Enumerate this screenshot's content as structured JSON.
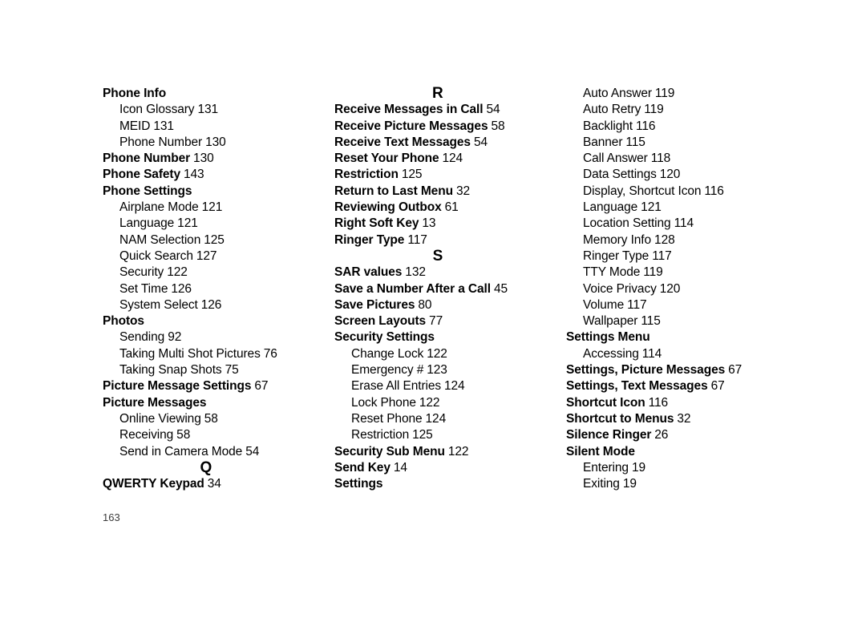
{
  "document": {
    "page_number": "163",
    "type": "index"
  },
  "columns": [
    {
      "id": "column-1",
      "blocks": [
        {
          "kind": "entries",
          "entries": [
            {
              "label": "Phone Info",
              "page": "",
              "level": "main"
            },
            {
              "label": "Icon Glossary",
              "page": "131",
              "level": "sub"
            },
            {
              "label": "MEID",
              "page": "131",
              "level": "sub"
            },
            {
              "label": "Phone Number",
              "page": "130",
              "level": "sub"
            },
            {
              "label": "Phone Number",
              "page": "130",
              "level": "main"
            },
            {
              "label": "Phone Safety",
              "page": "143",
              "level": "main"
            },
            {
              "label": "Phone Settings",
              "page": "",
              "level": "main"
            },
            {
              "label": "Airplane Mode",
              "page": "121",
              "level": "sub"
            },
            {
              "label": "Language",
              "page": "121",
              "level": "sub"
            },
            {
              "label": "NAM Selection",
              "page": "125",
              "level": "sub"
            },
            {
              "label": "Quick Search",
              "page": "127",
              "level": "sub"
            },
            {
              "label": "Security",
              "page": "122",
              "level": "sub"
            },
            {
              "label": "Set Time",
              "page": "126",
              "level": "sub"
            },
            {
              "label": "System Select",
              "page": "126",
              "level": "sub"
            },
            {
              "label": "Photos",
              "page": "",
              "level": "main"
            },
            {
              "label": "Sending",
              "page": "92",
              "level": "sub"
            },
            {
              "label": "Taking Multi Shot Pictures",
              "page": "76",
              "level": "sub"
            },
            {
              "label": "Taking Snap Shots",
              "page": "75",
              "level": "sub"
            },
            {
              "label": "Picture Message Settings",
              "page": "67",
              "level": "main"
            },
            {
              "label": "Picture Messages",
              "page": "",
              "level": "main"
            },
            {
              "label": "Online Viewing",
              "page": "58",
              "level": "sub"
            },
            {
              "label": "Receiving",
              "page": "58",
              "level": "sub"
            },
            {
              "label": "Send in Camera Mode",
              "page": "54",
              "level": "sub"
            }
          ]
        },
        {
          "kind": "letter",
          "letter": "Q"
        },
        {
          "kind": "entries",
          "entries": [
            {
              "label": "QWERTY Keypad",
              "page": "34",
              "level": "main"
            }
          ]
        }
      ]
    },
    {
      "id": "column-2",
      "blocks": [
        {
          "kind": "letter",
          "letter": "R"
        },
        {
          "kind": "entries",
          "entries": [
            {
              "label": "Receive Messages in Call",
              "page": "54",
              "level": "main"
            },
            {
              "label": "Receive Picture Messages",
              "page": "58",
              "level": "main"
            },
            {
              "label": "Receive Text Messages",
              "page": "54",
              "level": "main"
            },
            {
              "label": "Reset Your Phone",
              "page": "124",
              "level": "main"
            },
            {
              "label": "Restriction",
              "page": "125",
              "level": "main"
            },
            {
              "label": "Return to Last Menu",
              "page": "32",
              "level": "main"
            },
            {
              "label": "Reviewing Outbox",
              "page": "61",
              "level": "main"
            },
            {
              "label": "Right Soft Key",
              "page": "13",
              "level": "main"
            },
            {
              "label": "Ringer Type",
              "page": "117",
              "level": "main"
            }
          ]
        },
        {
          "kind": "letter",
          "letter": "S"
        },
        {
          "kind": "entries",
          "entries": [
            {
              "label": "SAR values",
              "page": "132",
              "level": "main"
            },
            {
              "label": "Save a Number After a Call",
              "page": "45",
              "level": "main"
            },
            {
              "label": "Save Pictures",
              "page": "80",
              "level": "main"
            },
            {
              "label": "Screen Layouts",
              "page": "77",
              "level": "main"
            },
            {
              "label": "Security Settings",
              "page": "",
              "level": "main"
            },
            {
              "label": "Change Lock",
              "page": "122",
              "level": "sub"
            },
            {
              "label": "Emergency #",
              "page": "123",
              "level": "sub"
            },
            {
              "label": "Erase All Entries",
              "page": "124",
              "level": "sub"
            },
            {
              "label": "Lock Phone",
              "page": "122",
              "level": "sub"
            },
            {
              "label": "Reset Phone",
              "page": "124",
              "level": "sub"
            },
            {
              "label": "Restriction",
              "page": "125",
              "level": "sub"
            },
            {
              "label": "Security Sub Menu",
              "page": "122",
              "level": "main"
            },
            {
              "label": "Send Key",
              "page": "14",
              "level": "main"
            },
            {
              "label": "Settings",
              "page": "",
              "level": "main"
            }
          ]
        }
      ]
    },
    {
      "id": "column-3",
      "blocks": [
        {
          "kind": "entries",
          "entries": [
            {
              "label": "Auto Answer",
              "page": "119",
              "level": "sub"
            },
            {
              "label": "Auto Retry",
              "page": "119",
              "level": "sub"
            },
            {
              "label": "Backlight",
              "page": "116",
              "level": "sub"
            },
            {
              "label": "Banner",
              "page": "115",
              "level": "sub"
            },
            {
              "label": "Call Answer",
              "page": "118",
              "level": "sub"
            },
            {
              "label": "Data Settings",
              "page": "120",
              "level": "sub"
            },
            {
              "label": "Display, Shortcut Icon",
              "page": "116",
              "level": "sub"
            },
            {
              "label": "Language",
              "page": "121",
              "level": "sub"
            },
            {
              "label": "Location Setting",
              "page": "114",
              "level": "sub"
            },
            {
              "label": "Memory Info",
              "page": "128",
              "level": "sub"
            },
            {
              "label": "Ringer Type",
              "page": "117",
              "level": "sub"
            },
            {
              "label": "TTY Mode",
              "page": "119",
              "level": "sub"
            },
            {
              "label": "Voice Privacy",
              "page": "120",
              "level": "sub"
            },
            {
              "label": "Volume",
              "page": "117",
              "level": "sub"
            },
            {
              "label": "Wallpaper",
              "page": "115",
              "level": "sub"
            },
            {
              "label": "Settings Menu",
              "page": "",
              "level": "main"
            },
            {
              "label": "Accessing",
              "page": "114",
              "level": "sub"
            },
            {
              "label": "Settings, Picture Messages",
              "page": "67",
              "level": "main"
            },
            {
              "label": "Settings, Text Messages",
              "page": "67",
              "level": "main"
            },
            {
              "label": "Shortcut Icon",
              "page": "116",
              "level": "main"
            },
            {
              "label": "Shortcut to Menus",
              "page": "32",
              "level": "main"
            },
            {
              "label": "Silence Ringer",
              "page": "26",
              "level": "main"
            },
            {
              "label": "Silent Mode",
              "page": "",
              "level": "main"
            },
            {
              "label": "Entering",
              "page": "19",
              "level": "sub"
            },
            {
              "label": "Exiting",
              "page": "19",
              "level": "sub"
            }
          ]
        }
      ]
    }
  ]
}
